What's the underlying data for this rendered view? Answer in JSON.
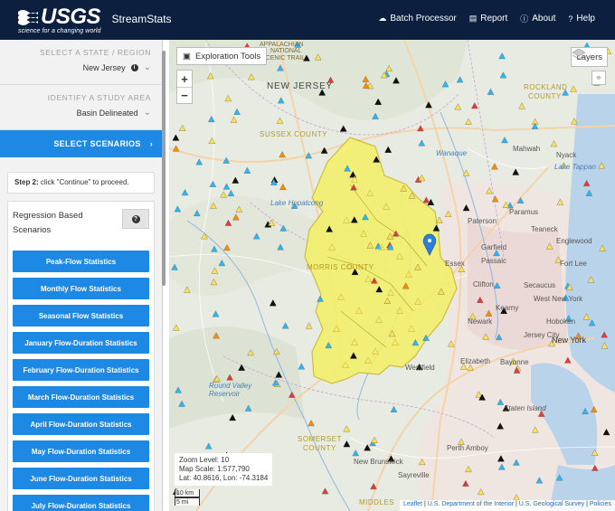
{
  "header": {
    "logo_text": "USGS",
    "logo_tagline": "science for a changing world",
    "app_title": "StreamStats",
    "nav": [
      {
        "icon": "cloud-upload-icon",
        "label": "Batch Processor"
      },
      {
        "icon": "report-icon",
        "label": "Report"
      },
      {
        "icon": "info-icon",
        "label": "About"
      },
      {
        "icon": "help-icon",
        "label": "Help"
      }
    ]
  },
  "sidebar": {
    "state_label": "SELECT A STATE / REGION",
    "state_value": "New Jersey",
    "study_label": "IDENTIFY A STUDY AREA",
    "study_value": "Basin Delineated",
    "scenarios_label": "SELECT SCENARIOS",
    "step_bold": "Step 2:",
    "step_text": " click \"Continue\" to proceed.",
    "regression_title_1": "Regression Based",
    "regression_title_2": "Scenarios",
    "regression_items": [
      "Peak-Flow Statistics",
      "Monthly Flow Statistics",
      "Seasonal Flow Statistics",
      "January Flow-Duration Statistics",
      "February Flow-Duration Statistics",
      "March Flow-Duration Statistics",
      "April Flow-Duration Statistics",
      "May Flow-Duration Statistics",
      "June Flow-Duration Statistics",
      "July Flow-Duration Statistics"
    ]
  },
  "map": {
    "exploration_label": "Exploration Tools",
    "layers_label": "Layers",
    "zoom_in": "+",
    "zoom_out": "−",
    "zoom_level": "Zoom Level: 10",
    "map_scale": "Map Scale: 1:577,790",
    "lat_lon": "Lat: 40.8616, Lon: -74.3184",
    "scale_km": "10 km",
    "scale_mi": "5 mi",
    "attribution_leaflet": "Leaflet",
    "attribution_doi": "U.S. Department of the Interior",
    "attribution_usgs": "U.S. Geological Survey",
    "attribution_policies": "Policies",
    "labels": {
      "new_jersey": "NEW JERSEY",
      "appalachian": "APPALACHIAN",
      "national": "NATIONAL",
      "scenic_trail": "SCENIC TRAIL",
      "sussex": "SUSSEX COUNTY",
      "morris": "MORRIS COUNTY",
      "somerset": "SOMERSET",
      "county": "COUNTY",
      "middlesex": "MIDDLES",
      "rockland_1": "ROCKLAND",
      "rockland_2": "COUNTY",
      "essex": "Essex",
      "new_york": "New York",
      "lake_hopatcong": "Lake Hopatcong",
      "round_valley": "Round Valley",
      "reservoir": "Reservoir",
      "paterson": "Paterson",
      "newark": "Newark",
      "hoboken": "Hoboken",
      "bayonne": "Bayonne",
      "elizabeth": "Elizabeth",
      "westfield": "Westfield",
      "perth_amboy": "Perth Amboy",
      "new_brunswick": "New Brunswick",
      "sayreville": "Sayreville",
      "staten_island": "Staten Island",
      "passaic": "Passaic",
      "garfield": "Garfield",
      "englewood": "Englewood",
      "ramapo": "Ramapo",
      "wanaque": "Wanaque",
      "nyack": "Nyack",
      "tappan": "Lake Tappan",
      "fort_lee": "Fort Lee",
      "west_ny": "West New York",
      "jersey_city": "Jersey City",
      "kearny": "Kearny",
      "mahwah": "Mahwah",
      "secaucus": "Secaucus",
      "teaneck": "Teaneck",
      "paramus": "Paramus",
      "clifton": "Clifton"
    }
  }
}
